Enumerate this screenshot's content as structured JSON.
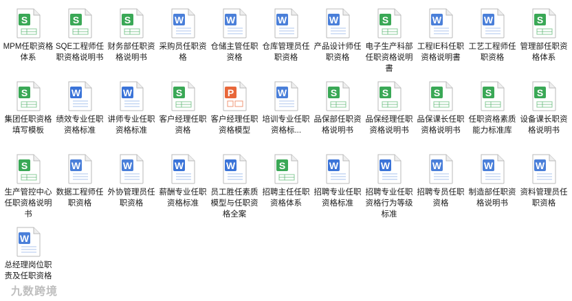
{
  "files": [
    {
      "name": "MPM任职资格体系",
      "type": "S"
    },
    {
      "name": "SQE工程师任职资格说明书",
      "type": "S"
    },
    {
      "name": "财务部任职资格说明书",
      "type": "S"
    },
    {
      "name": "采购员任职资格",
      "type": "W"
    },
    {
      "name": "仓储主管任职资格",
      "type": "W"
    },
    {
      "name": "仓库管理员任职资格",
      "type": "W"
    },
    {
      "name": "产品设计师任职资格",
      "type": "W"
    },
    {
      "name": "电子生产科部任职资格说明書",
      "type": "S"
    },
    {
      "name": "工程IE科任职资格说明書",
      "type": "W"
    },
    {
      "name": "工艺工程师任职资格",
      "type": "W"
    },
    {
      "name": "管理部任职资格体系",
      "type": "S"
    },
    {
      "name": "集团任职资格填写模板",
      "type": "S"
    },
    {
      "name": "绩效专业任职资格标准",
      "type": "W2"
    },
    {
      "name": "讲师专业任职资格标准",
      "type": "W2"
    },
    {
      "name": "客户经理任职资格",
      "type": "S2"
    },
    {
      "name": "客户经理任职资格模型",
      "type": "P"
    },
    {
      "name": "培训专业任职资格标...",
      "type": "W"
    },
    {
      "name": "品保部任职资格说明书",
      "type": "S"
    },
    {
      "name": "品保经理任职资格说明书",
      "type": "S"
    },
    {
      "name": "品保课长任职资格说明书",
      "type": "S"
    },
    {
      "name": "任职资格素质能力标准库",
      "type": "S"
    },
    {
      "name": "设备课长职资格说明书",
      "type": "S"
    },
    {
      "name": "生产管控中心任职资格说明书",
      "type": "S"
    },
    {
      "name": "数据工程师任职资格",
      "type": "W"
    },
    {
      "name": "外协管理员任职资格",
      "type": "W"
    },
    {
      "name": "薪酬专业任职资格标准",
      "type": "W2"
    },
    {
      "name": "员工胜任素质模型与任职资格全案",
      "type": "W2"
    },
    {
      "name": "招聘主任任职资格体系",
      "type": "S"
    },
    {
      "name": "招聘专业任职资格标准",
      "type": "W2"
    },
    {
      "name": "招聘专业任职资格行为等级标准",
      "type": "W2"
    },
    {
      "name": "招聘专员任职资格",
      "type": "W"
    },
    {
      "name": "制造部任职资格说明书",
      "type": "W"
    },
    {
      "name": "资料管理员任职资格",
      "type": "W"
    },
    {
      "name": "总经理岗位职责及任职资格",
      "type": "W"
    }
  ],
  "icon_letters": {
    "S": "S",
    "S2": "S",
    "W": "W",
    "W2": "W",
    "P": "P"
  },
  "colors": {
    "S": "#3aa856",
    "S2": "#3aa856",
    "W": "#4a7fd9",
    "W2": "#3b74d8",
    "P": "#e8673a",
    "icon_border": "#b9b9b9",
    "icon_bg": "#ffffff",
    "text": "#1a1a1a"
  },
  "watermark": "九数跨境"
}
